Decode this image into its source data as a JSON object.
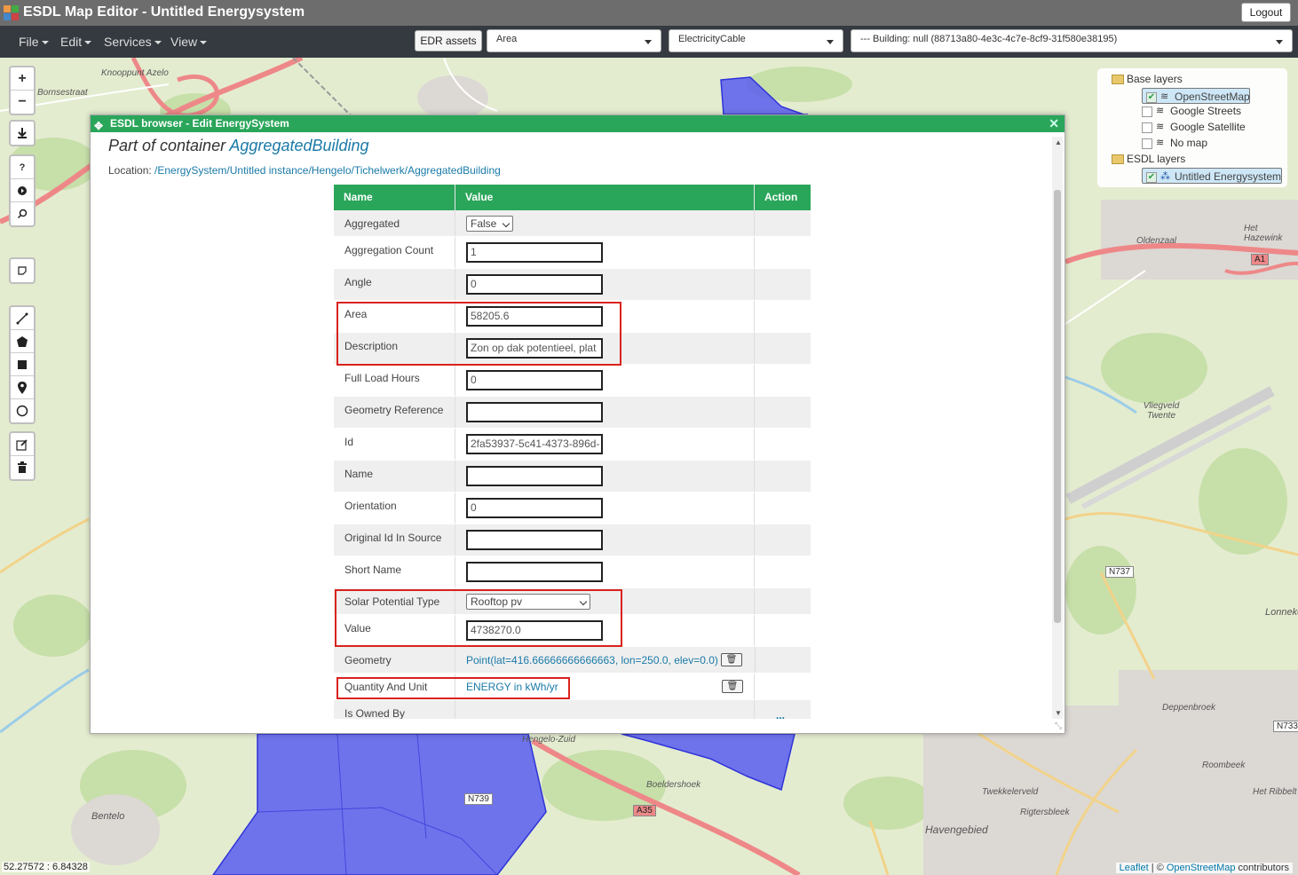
{
  "app": {
    "title": "ESDL Map Editor - Untitled Energysystem",
    "logout_label": "Logout"
  },
  "menu": {
    "items": [
      {
        "label": "File"
      },
      {
        "label": "Edit"
      },
      {
        "label": "Services"
      },
      {
        "label": "View"
      }
    ],
    "edr_label": "EDR assets",
    "select_type": "Area",
    "select_asset": "ElectricityCable",
    "select_building": "--- Building: null (88713a80-4e3c-4c7e-8cf9-31f580e38195)"
  },
  "map": {
    "labels": {
      "knooppunt": "Knooppunt Azelo",
      "bornsestraat": "Bornsestraat",
      "oldenzaal": "Oldenzaal",
      "vliegveld": "Vliegveld\nTwente",
      "het_hazewink": "Het Hazewink",
      "deppenbroek": "Deppenbroek",
      "roombeek": "Roombeek",
      "twekkelerveld": "Twekkelerveld",
      "rigtersbleek": "Rigtersbleek",
      "havengebied": "Havengebied",
      "boeldershoek": "Boeldershoek",
      "bentelo": "Bentelo",
      "hengelo_zuid": "Hengelo-Zuid",
      "het_ribbelt": "Het Ribbelt",
      "lonneker": "Lonneker"
    },
    "badges": {
      "a1": "A1",
      "n737": "N737",
      "n739": "N739",
      "a35": "A35",
      "n733": "N733"
    },
    "coords": "52.27572 : 6.84328",
    "attribution": {
      "leaflet": "Leaflet",
      "sep": " | © ",
      "osm": "OpenStreetMap",
      "suffix": " contributors"
    }
  },
  "controls": {
    "zoom_in": "+",
    "zoom_out": "−",
    "help": "?"
  },
  "layers": {
    "base_title": "Base layers",
    "base": [
      {
        "label": "OpenStreetMap",
        "checked": true
      },
      {
        "label": "Google Streets",
        "checked": false
      },
      {
        "label": "Google Satellite",
        "checked": false
      },
      {
        "label": "No map",
        "checked": false
      }
    ],
    "esdl_title": "ESDL layers",
    "esdl": [
      {
        "label": "Untitled Energysystem",
        "checked": true
      }
    ]
  },
  "dialog": {
    "title": "ESDL browser - Edit EnergySystem",
    "container_prefix": "Part of container ",
    "container_name": "AggregatedBuilding",
    "location_prefix": "Location: ",
    "location_path": "/EnergySystem/Untitled instance/Hengelo/Tichelwerk/AggregatedBuilding",
    "columns": {
      "name": "Name",
      "value": "Value",
      "action": "Action"
    },
    "rows": {
      "aggregated": {
        "name": "Aggregated",
        "value": "False"
      },
      "aggregation_count": {
        "name": "Aggregation Count",
        "value": "1"
      },
      "angle": {
        "name": "Angle",
        "value": "0"
      },
      "area": {
        "name": "Area",
        "value": "58205.6"
      },
      "description": {
        "name": "Description",
        "value": "Zon op dak potentieel, plat"
      },
      "full_load_hours": {
        "name": "Full Load Hours",
        "value": "0"
      },
      "geometry_reference": {
        "name": "Geometry Reference",
        "value": ""
      },
      "id": {
        "name": "Id",
        "value": "2fa53937-5c41-4373-896d-"
      },
      "name": {
        "name": "Name",
        "value": ""
      },
      "orientation": {
        "name": "Orientation",
        "value": "0"
      },
      "original_id": {
        "name": "Original Id In Source",
        "value": ""
      },
      "short_name": {
        "name": "Short Name",
        "value": ""
      },
      "solar_type": {
        "name": "Solar Potential Type",
        "value": "Rooftop pv"
      },
      "value": {
        "name": "Value",
        "value": "4738270.0"
      },
      "geometry": {
        "name": "Geometry",
        "value": "Point(lat=416.66666666666663, lon=250.0, elev=0.0)"
      },
      "quantity_unit": {
        "name": "Quantity And Unit",
        "value": "ENERGY in kWh/yr"
      },
      "is_owned_by": {
        "name": "Is Owned By",
        "value": "..."
      }
    }
  },
  "colors": {
    "header": "#6d6d6d",
    "menubar": "#343a40",
    "accent": "#2aa65a",
    "highlight": "#d9221d",
    "link": "#1a7aa8",
    "polygon": "#5b5ef0"
  }
}
